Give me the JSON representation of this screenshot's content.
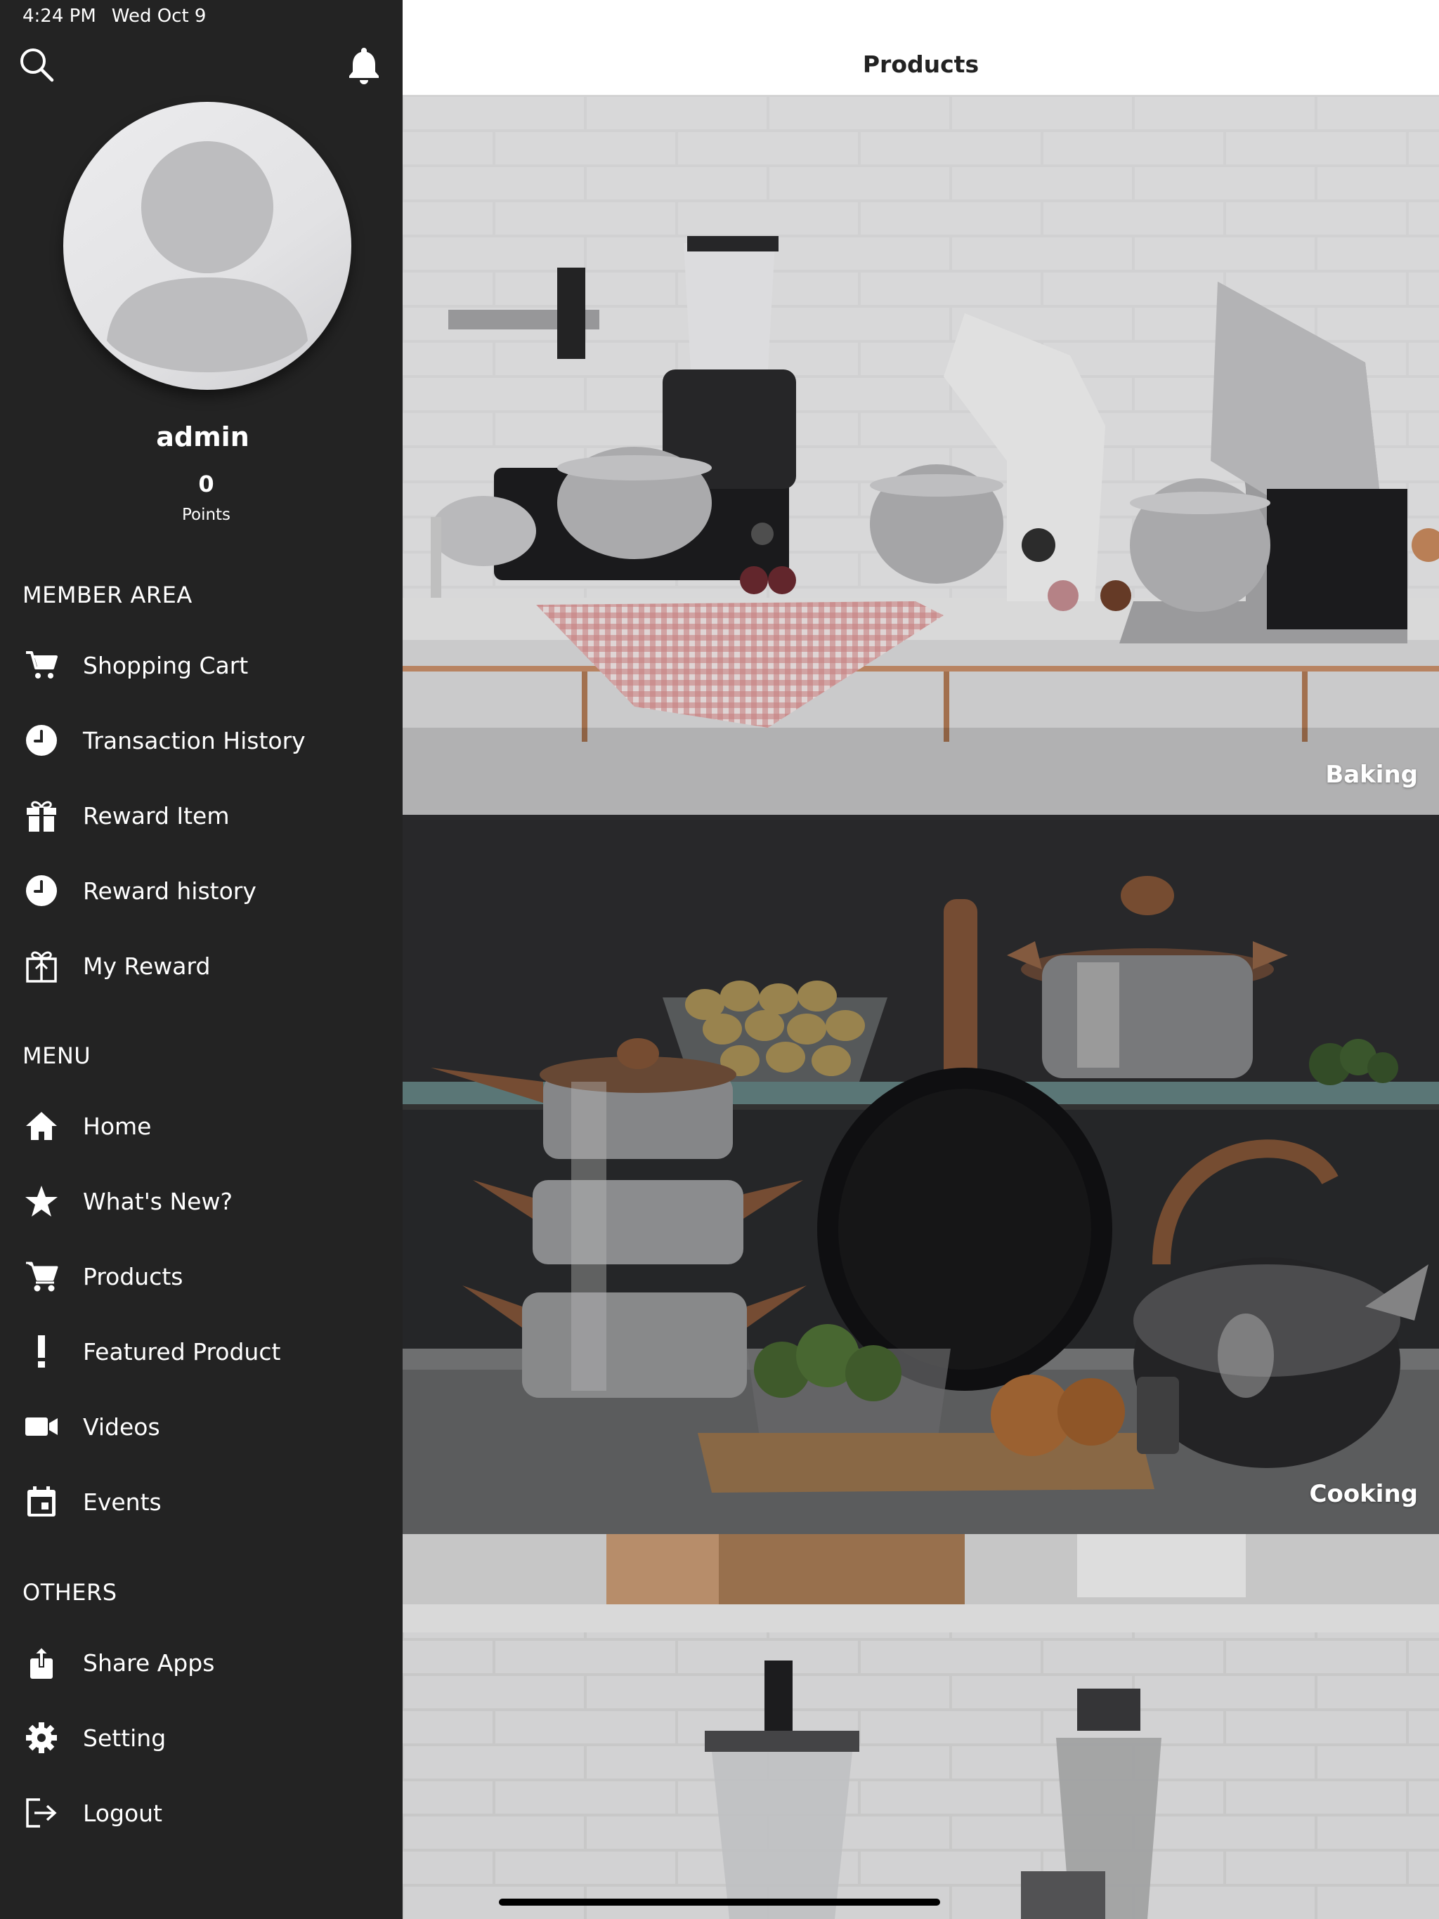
{
  "status_bar": {
    "time": "4:24 PM",
    "date": "Wed Oct 9"
  },
  "profile": {
    "name": "admin",
    "points": "0",
    "points_label": "Points"
  },
  "sections": {
    "member": "MEMBER AREA",
    "menu": "MENU",
    "others": "OTHERS"
  },
  "member_items": [
    {
      "label": "Shopping Cart",
      "icon": "cart-icon"
    },
    {
      "label": "Transaction History",
      "icon": "clock-icon"
    },
    {
      "label": "Reward Item",
      "icon": "gift-icon"
    },
    {
      "label": "Reward history",
      "icon": "clock-icon"
    },
    {
      "label": "My Reward",
      "icon": "gift-outline-icon"
    }
  ],
  "menu_items": [
    {
      "label": "Home",
      "icon": "home-icon"
    },
    {
      "label": "What's New?",
      "icon": "star-icon"
    },
    {
      "label": "Products",
      "icon": "cart-icon"
    },
    {
      "label": "Featured Product",
      "icon": "exclamation-icon"
    },
    {
      "label": "Videos",
      "icon": "video-camera-icon"
    },
    {
      "label": "Events",
      "icon": "calendar-icon"
    }
  ],
  "others_items": [
    {
      "label": "Share Apps",
      "icon": "share-icon"
    },
    {
      "label": "Setting",
      "icon": "gear-icon"
    },
    {
      "label": "Logout",
      "icon": "logout-icon"
    }
  ],
  "header": {
    "title": "Products"
  },
  "categories": [
    {
      "label": "Baking"
    },
    {
      "label": "Cooking"
    }
  ],
  "colors": {
    "sidebar_bg": "#232323",
    "text": "#ffffff",
    "header_bg": "#ffffff"
  }
}
